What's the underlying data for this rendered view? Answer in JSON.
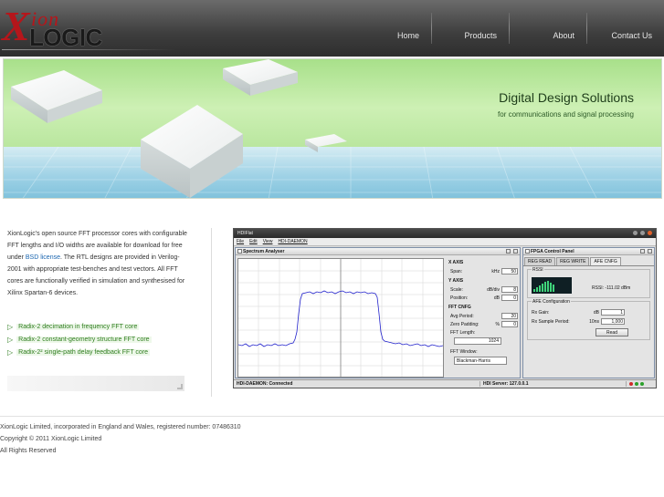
{
  "logo": {
    "x": "X",
    "ion": "ion",
    "logic": "LOGIC"
  },
  "nav": {
    "items": [
      {
        "label": "Home"
      },
      {
        "label": "Products"
      },
      {
        "label": "About"
      },
      {
        "label": "Contact Us"
      }
    ]
  },
  "banner": {
    "title": "Digital Design Solutions",
    "subtitle": "for communications and signal processing"
  },
  "intro": {
    "part1": "XionLogic's open source FFT processor cores with configurable FFT lengths and I/O widths are available for download for free under ",
    "link": "BSD license",
    "part2": ". The RTL designs are provided in Verilog-2001 with appropriate test-benches and test vectors. All FFT cores are functionally verified in simulation and synthesised for Xilinx Spartan-6 devices."
  },
  "features": [
    {
      "label": "Radix-2 decimation in frequency FFT core"
    },
    {
      "label": "Radix-2 constant-geometry structure FFT core"
    },
    {
      "label": "Radix-2² single-path delay feedback FFT core"
    }
  ],
  "app": {
    "title": "HDIFlat",
    "menu": [
      "File",
      "Edit",
      "View",
      "HDI-DAEMON"
    ],
    "spectrum": {
      "title": "Spectrum Analyser",
      "x_axis": "X AXIS",
      "span_label": "Span:",
      "span_unit": "kHz",
      "span_value": "50",
      "y_axis": "Y AXIS",
      "scale_label": "Scale:",
      "scale_unit": "dB/div",
      "scale_value": "8",
      "position_label": "Position:",
      "position_unit": "dB",
      "position_value": "0",
      "fft_cnfg": "FFT CNFG",
      "avg_label": "Avg Period:",
      "avg_value": "20",
      "zero_label": "Zero Padding:",
      "zero_unit": "%",
      "zero_value": "0",
      "length_label": "FFT Length:",
      "length_value": "1024",
      "window_label": "FFT Window:",
      "window_value": "Blackman-Harris"
    },
    "fpga": {
      "title": "FPGA Control Panel",
      "tabs": [
        "REG READ",
        "REG WRITE",
        "AFE CNFG"
      ],
      "rssi_group": "RSSI",
      "rssi_text": "RSSI: -111.02 dBm",
      "afe_group": "AFE Configuration",
      "rx_gain_label": "Rx Gain:",
      "rx_gain_unit": "dB",
      "rx_gain_value": "1",
      "rx_period_label": "Rx Sample Period:",
      "rx_period_unit": "10ns",
      "rx_period_value": "1,000",
      "read_label": "Read"
    },
    "status": {
      "left": "HDI-DAEMON: Connected",
      "right": "HDI Server: 127.0.0.1"
    }
  },
  "footer": {
    "line1": "XionLogic Limited, incorporated in England and Wales, registered number: 07486310",
    "line2": "Copyright © 2011 XionLogic Limited",
    "line3": "All Rights Reserved"
  },
  "colors": {
    "brand_red": "#b5161b",
    "link_blue": "#1b66b0",
    "feature_green": "#2e7d1e"
  }
}
